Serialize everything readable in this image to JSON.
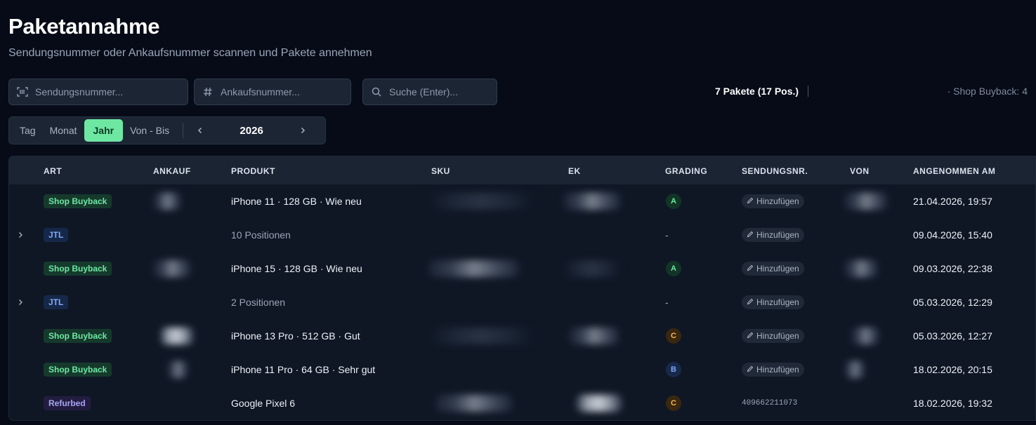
{
  "header": {
    "title": "Paketannahme",
    "subtitle": "Sendungsnummer oder Ankaufsnummer scannen und Pakete annehmen"
  },
  "inputs": {
    "shipment_placeholder": "Sendungsnummer...",
    "purchase_placeholder": "Ankaufsnummer...",
    "search_placeholder": "Suche (Enter)..."
  },
  "stats": {
    "summary": "7 Pakete (17 Pos.)",
    "shop_buyback": "· Shop Buyback: 4"
  },
  "period": {
    "tabs": [
      "Tag",
      "Monat",
      "Jahr",
      "Von - Bis"
    ],
    "active": "Jahr",
    "year": "2026"
  },
  "table": {
    "columns": {
      "art": "ART",
      "ankauf": "ANKAUF",
      "produkt": "PRODUKT",
      "sku": "SKU",
      "ek": "EK",
      "grading": "GRADING",
      "sendungsnr": "SENDUNGSNR.",
      "von": "VON",
      "angenommen": "ANGENOMMEN AM"
    },
    "add_label": "Hinzufügen",
    "rows": [
      {
        "type": "Shop Buyback",
        "product": "iPhone 11 · 128 GB · Wie neu",
        "grade": "A",
        "tracking": "",
        "date": "21.04.2026, 19:57"
      },
      {
        "type": "JTL",
        "product": "10 Positionen",
        "grade": "-",
        "tracking": "",
        "date": "09.04.2026, 15:40"
      },
      {
        "type": "Shop Buyback",
        "product": "iPhone 15 · 128 GB · Wie neu",
        "grade": "A",
        "tracking": "",
        "date": "09.03.2026, 22:38"
      },
      {
        "type": "JTL",
        "product": "2 Positionen",
        "grade": "-",
        "tracking": "",
        "date": "05.03.2026, 12:29"
      },
      {
        "type": "Shop Buyback",
        "product": "iPhone 13 Pro · 512 GB · Gut",
        "grade": "C",
        "tracking": "",
        "date": "05.03.2026, 12:27"
      },
      {
        "type": "Shop Buyback",
        "product": "iPhone 11 Pro · 64 GB · Sehr gut",
        "grade": "B",
        "tracking": "",
        "date": "18.02.2026, 20:15"
      },
      {
        "type": "Refurbed",
        "product": "Google Pixel 6",
        "grade": "C",
        "tracking": "409662211073",
        "date": "18.02.2026, 19:32"
      }
    ]
  },
  "colors": {
    "background": "#060b17",
    "accent": "#6ee7a3",
    "jtl": "#7ea8f5",
    "refurbed": "#a8a4f3",
    "grade_c": "#f5b456"
  },
  "icons": [
    "barcode-scan-icon",
    "hash-icon",
    "search-icon",
    "chevron-left-icon",
    "chevron-right-icon",
    "pencil-icon"
  ]
}
